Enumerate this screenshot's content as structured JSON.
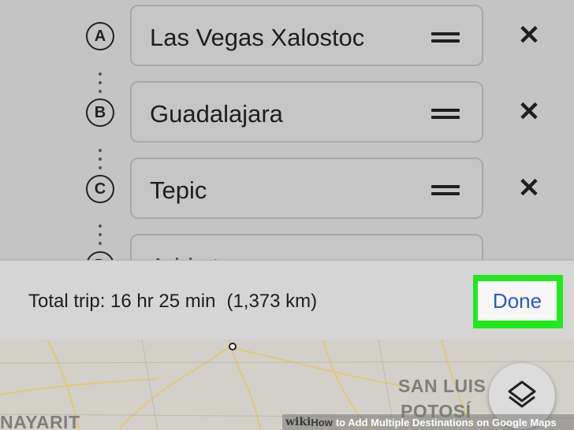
{
  "destinations": [
    {
      "marker": "A",
      "name": "Las Vegas Xalostoc"
    },
    {
      "marker": "B",
      "name": "Guadalajara"
    },
    {
      "marker": "C",
      "name": "Tepic"
    },
    {
      "marker": "D",
      "name": "Add stop"
    }
  ],
  "icons": {
    "drag": "drag-handle-icon",
    "remove": "close-icon",
    "layers": "layers-icon"
  },
  "remove_glyph": "✕",
  "summary": {
    "trip": "Total trip: 16 hr 25 min",
    "distance": "(1,373 km)",
    "done_label": "Done"
  },
  "highlight_color": "#22e81e",
  "accent_color": "#2c57c6",
  "map": {
    "labels": [
      "SAN LUIS",
      "POTOSÍ",
      "NAYARIT"
    ]
  },
  "watermark": {
    "prefix": "wiki",
    "how": "How",
    "title": "to Add Multiple Destinations on Google Maps"
  }
}
